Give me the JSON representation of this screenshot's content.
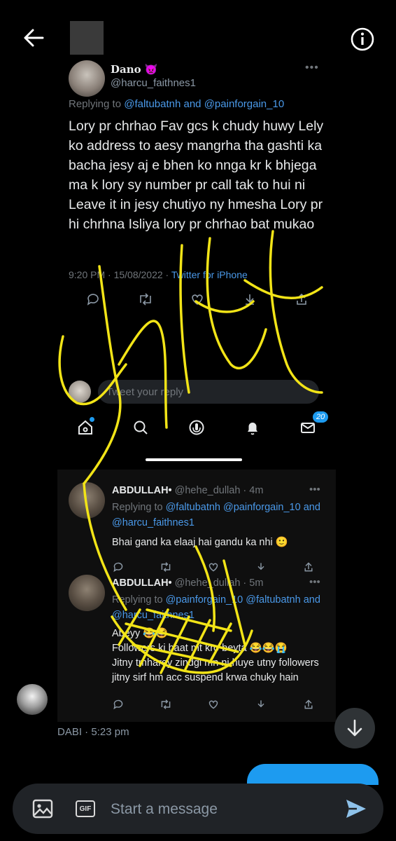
{
  "conversation": {
    "sender_name": "DABI",
    "sent_time": "5:23 pm"
  },
  "composer": {
    "placeholder": "Start a message",
    "gif_label": "GIF"
  },
  "shared_image": {
    "tweet": {
      "name": "Dano 👿",
      "handle": "@harcu_faithnes1",
      "replying_prefix": "Replying to ",
      "replying_users": "@faltubatnh and @painforgain_10",
      "body": "Lory pr chrhao Fav gcs k chudy huwy Lely ko address to aesy mangrha tha gashti ka bacha jesy aj e bhen ko nnga kr k bhjega ma k lory sy number pr call tak to hui ni Leave it in jesy chutiyo ny hmesha Lory pr hi chrhna Isliya lory pr chrhao bat mukao",
      "time": "9:20 PM · 15/08/2022 · ",
      "client": "Twitter for iPhone",
      "menu": "•••"
    },
    "reply_placeholder": "Tweet your reply",
    "notification_badge": "20",
    "replies": [
      {
        "name": "ABDULLAH•",
        "handle_time": " @hehe_dullah · 4m",
        "replying_prefix": "Replying to ",
        "replying_users": "@faltubatnh @painforgain_10 and @harcu_faithnes1",
        "text": "Bhai gand ka elaaj hai gandu ka nhi 🙂",
        "menu": "•••"
      },
      {
        "name": "ABDULLAH•",
        "handle_time": " @hehe_dullah · 5m",
        "replying_prefix": "Replying to ",
        "replying_users": "@painforgain_10 @faltubatnh and @harcu_faithnes1",
        "text": "Abeyy 😂😂\nFollowers ki baat mt kro beyta 😂😂😭\nJitny tmharey zindgi mn ni huye utny followers jitny sirf hm acc suspend krwa chuky hain",
        "menu": "•••"
      }
    ]
  },
  "colors": {
    "background": "#000000",
    "accent": "#1d9bf0",
    "link": "#4a99e9",
    "doodle": "#f2e417",
    "composer_bg": "#202327"
  }
}
